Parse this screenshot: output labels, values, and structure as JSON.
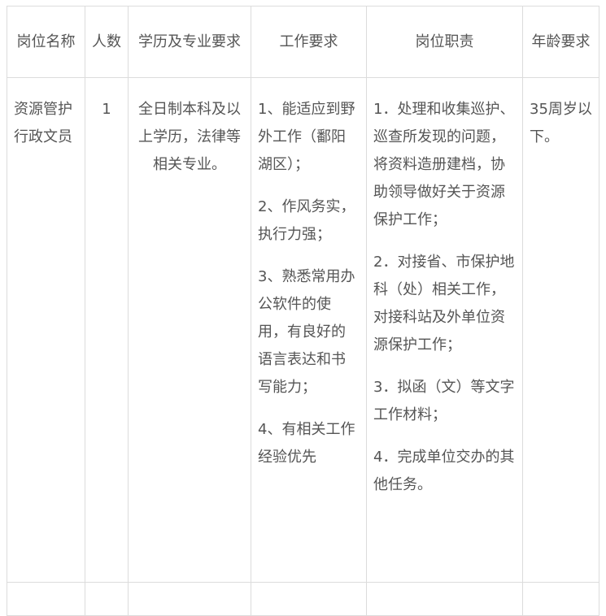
{
  "table": {
    "headers": [
      "岗位名称",
      "人数",
      "学历及专业要求",
      "工作要求",
      "岗位职责",
      "年龄要求"
    ],
    "row": {
      "position": "资源管护行政文员",
      "count": "1",
      "education": "全日制本科及以上学历，法律等相关专业。",
      "work_requirements": [
        "1、能适应到野外工作（鄱阳湖区）；",
        "2、作风务实，执行力强；",
        "3、熟悉常用办公软件的使用，有良好的语言表达和书写能力；",
        "4、有相关工作经验优先"
      ],
      "duties": [
        "1．处理和收集巡护、巡查所发现的问题，将资料造册建档，协助领导做好关于资源保护工作；",
        "2．对接省、市保护地科（处）相关工作，对接科站及外单位资源保护工作；",
        "3．拟函（文）等文字工作材料；",
        "4．完成单位交办的其他任务。"
      ],
      "age": "35周岁以下。"
    }
  }
}
